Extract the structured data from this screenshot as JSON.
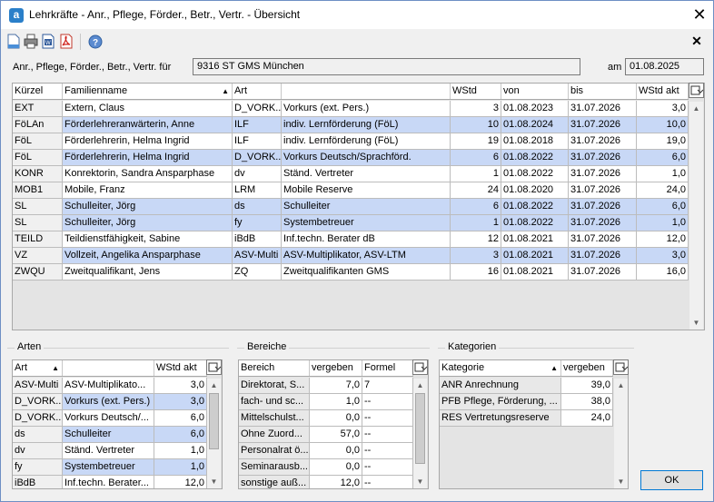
{
  "window": {
    "title": "Lehrkräfte - Anr., Pflege, Förder., Betr., Vertr. - Übersicht",
    "app_icon_letter": "a",
    "close_glyph": "✕"
  },
  "toolbar": {
    "close_glyph": "✕"
  },
  "filter": {
    "label": "Anr., Pflege, Förder., Betr., Vertr.  für",
    "school": "9316 ST GMS München",
    "date_label": "am",
    "date": "01.08.2025"
  },
  "main_table": {
    "headers": [
      "Kürzel",
      "Familienname",
      "Art",
      "",
      "WStd",
      "von",
      "bis",
      "WStd akt"
    ],
    "rows": [
      [
        "EXT",
        "Extern, Claus",
        "D_VORK...",
        "Vorkurs (ext. Pers.)",
        "3",
        "01.08.2023",
        "31.07.2026",
        "3,0"
      ],
      [
        "FöLAn",
        "Förderlehreranwärterin, Anne",
        "ILF",
        "indiv. Lernförderung (FöL)",
        "10",
        "01.08.2024",
        "31.07.2026",
        "10,0"
      ],
      [
        "FöL",
        "Förderlehrerin, Helma Ingrid",
        "ILF",
        "indiv. Lernförderung (FöL)",
        "19",
        "01.08.2018",
        "31.07.2026",
        "19,0"
      ],
      [
        "FöL",
        "Förderlehrerin, Helma Ingrid",
        "D_VORK...",
        "Vorkurs Deutsch/Sprachförd.",
        "6",
        "01.08.2022",
        "31.07.2026",
        "6,0"
      ],
      [
        "KONR",
        "Konrektorin, Sandra Ansparphase",
        "dv",
        "Ständ. Vertreter",
        "1",
        "01.08.2022",
        "31.07.2026",
        "1,0"
      ],
      [
        "MOB1",
        "Mobile, Franz",
        "LRM",
        "Mobile Reserve",
        "24",
        "01.08.2020",
        "31.07.2026",
        "24,0"
      ],
      [
        "SL",
        "Schulleiter, Jörg",
        "ds",
        "Schulleiter",
        "6",
        "01.08.2022",
        "31.07.2026",
        "6,0"
      ],
      [
        "SL",
        "Schulleiter, Jörg",
        "fy",
        "Systembetreuer",
        "1",
        "01.08.2022",
        "31.07.2026",
        "1,0"
      ],
      [
        "TEILD",
        "Teildienstfähigkeit, Sabine",
        "iBdB",
        "Inf.techn. Berater dB",
        "12",
        "01.08.2021",
        "31.07.2026",
        "12,0"
      ],
      [
        "VZ",
        "Vollzeit, Angelika Ansparphase",
        "ASV-Multi",
        "ASV-Multiplikator, ASV-LTM",
        "3",
        "01.08.2021",
        "31.07.2026",
        "3,0"
      ],
      [
        "ZWQU",
        "Zweitqualifikant, Jens",
        "ZQ",
        "Zweitqualifikanten GMS",
        "16",
        "01.08.2021",
        "31.07.2026",
        "16,0"
      ]
    ]
  },
  "arten": {
    "title": "Arten",
    "headers": [
      "Art",
      "",
      "WStd akt"
    ],
    "rows": [
      [
        "ASV-Multi",
        "ASV-Multiplikato...",
        "3,0"
      ],
      [
        "D_VORK...",
        "Vorkurs (ext. Pers.)",
        "3,0"
      ],
      [
        "D_VORK...",
        "Vorkurs Deutsch/...",
        "6,0"
      ],
      [
        "ds",
        "Schulleiter",
        "6,0"
      ],
      [
        "dv",
        "Ständ. Vertreter",
        "1,0"
      ],
      [
        "fy",
        "Systembetreuer",
        "1,0"
      ],
      [
        "iBdB",
        "Inf.techn. Berater...",
        "12,0"
      ]
    ]
  },
  "bereiche": {
    "title": "Bereiche",
    "headers": [
      "Bereich",
      "vergeben",
      "Formel"
    ],
    "rows": [
      [
        "Direktorat, S...",
        "7,0",
        "7"
      ],
      [
        "fach- und sc...",
        "1,0",
        "--"
      ],
      [
        "Mittelschulst...",
        "0,0",
        "--"
      ],
      [
        "Ohne Zuord...",
        "57,0",
        "--"
      ],
      [
        "Personalrat ö...",
        "0,0",
        "--"
      ],
      [
        "Seminarausb...",
        "0,0",
        "--"
      ],
      [
        "sonstige auß...",
        "12,0",
        "--"
      ]
    ]
  },
  "kategorien": {
    "title": "Kategorien",
    "headers": [
      "Kategorie",
      "vergeben"
    ],
    "rows": [
      [
        "ANR Anrechnung",
        "39,0"
      ],
      [
        "PFB Pflege, Förderung, ...",
        "38,0"
      ],
      [
        "RES Vertretungsreserve",
        "24,0"
      ]
    ]
  },
  "ok_label": "OK"
}
